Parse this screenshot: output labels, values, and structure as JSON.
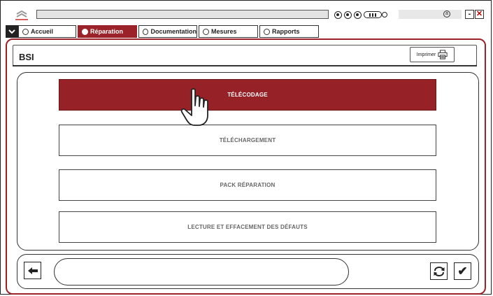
{
  "app": {
    "title_bar_text": ""
  },
  "tabs": [
    {
      "label": "Accueil",
      "active": false
    },
    {
      "label": "Réparation",
      "active": true
    },
    {
      "label": "Documentation",
      "active": false
    },
    {
      "label": "Mesures",
      "active": false
    },
    {
      "label": "Rapports",
      "active": false
    }
  ],
  "header": {
    "title": "BSI",
    "print_label": "Imprimer"
  },
  "options": [
    {
      "label": "TÉLÉCODAGE",
      "selected": true
    },
    {
      "label": "TÉLÉCHARGEMENT",
      "selected": false
    },
    {
      "label": "PACK RÉPARATION",
      "selected": false
    },
    {
      "label": "LECTURE ET EFFACEMENT DES DÉFAUTS",
      "selected": false
    }
  ],
  "bottom": {
    "message": "",
    "confirm_glyph": "✔"
  },
  "icons": {
    "status": [
      "status-icon-1",
      "status-icon-2",
      "status-icon-3",
      "battery-icon"
    ],
    "window": [
      "minimize-icon",
      "close-icon"
    ]
  },
  "colors": {
    "accent": "#9b2228",
    "selected_option": "#962127",
    "close": "#c00000"
  }
}
